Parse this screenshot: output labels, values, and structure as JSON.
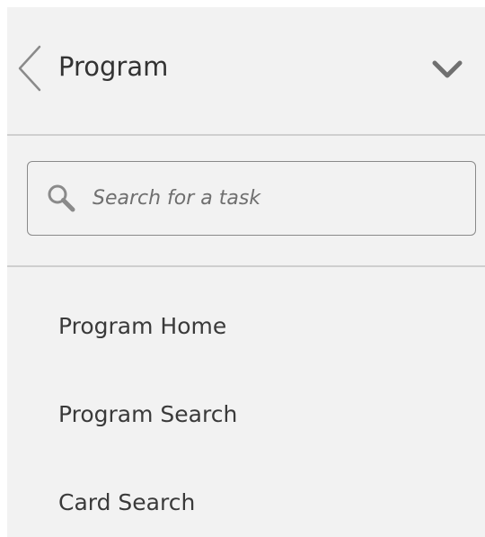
{
  "header": {
    "title": "Program",
    "back_icon": "chevron-left-icon",
    "collapse_icon": "chevron-down-icon"
  },
  "search": {
    "placeholder": "Search for a task",
    "value": "",
    "icon": "search-icon"
  },
  "nav": {
    "items": [
      {
        "label": "Program Home"
      },
      {
        "label": "Program Search"
      },
      {
        "label": "Card Search"
      }
    ]
  },
  "colors": {
    "panel_background": "#f2f2f2",
    "text": "#333333",
    "divider": "#cfcfcf",
    "icon": "#8a8a8a"
  }
}
